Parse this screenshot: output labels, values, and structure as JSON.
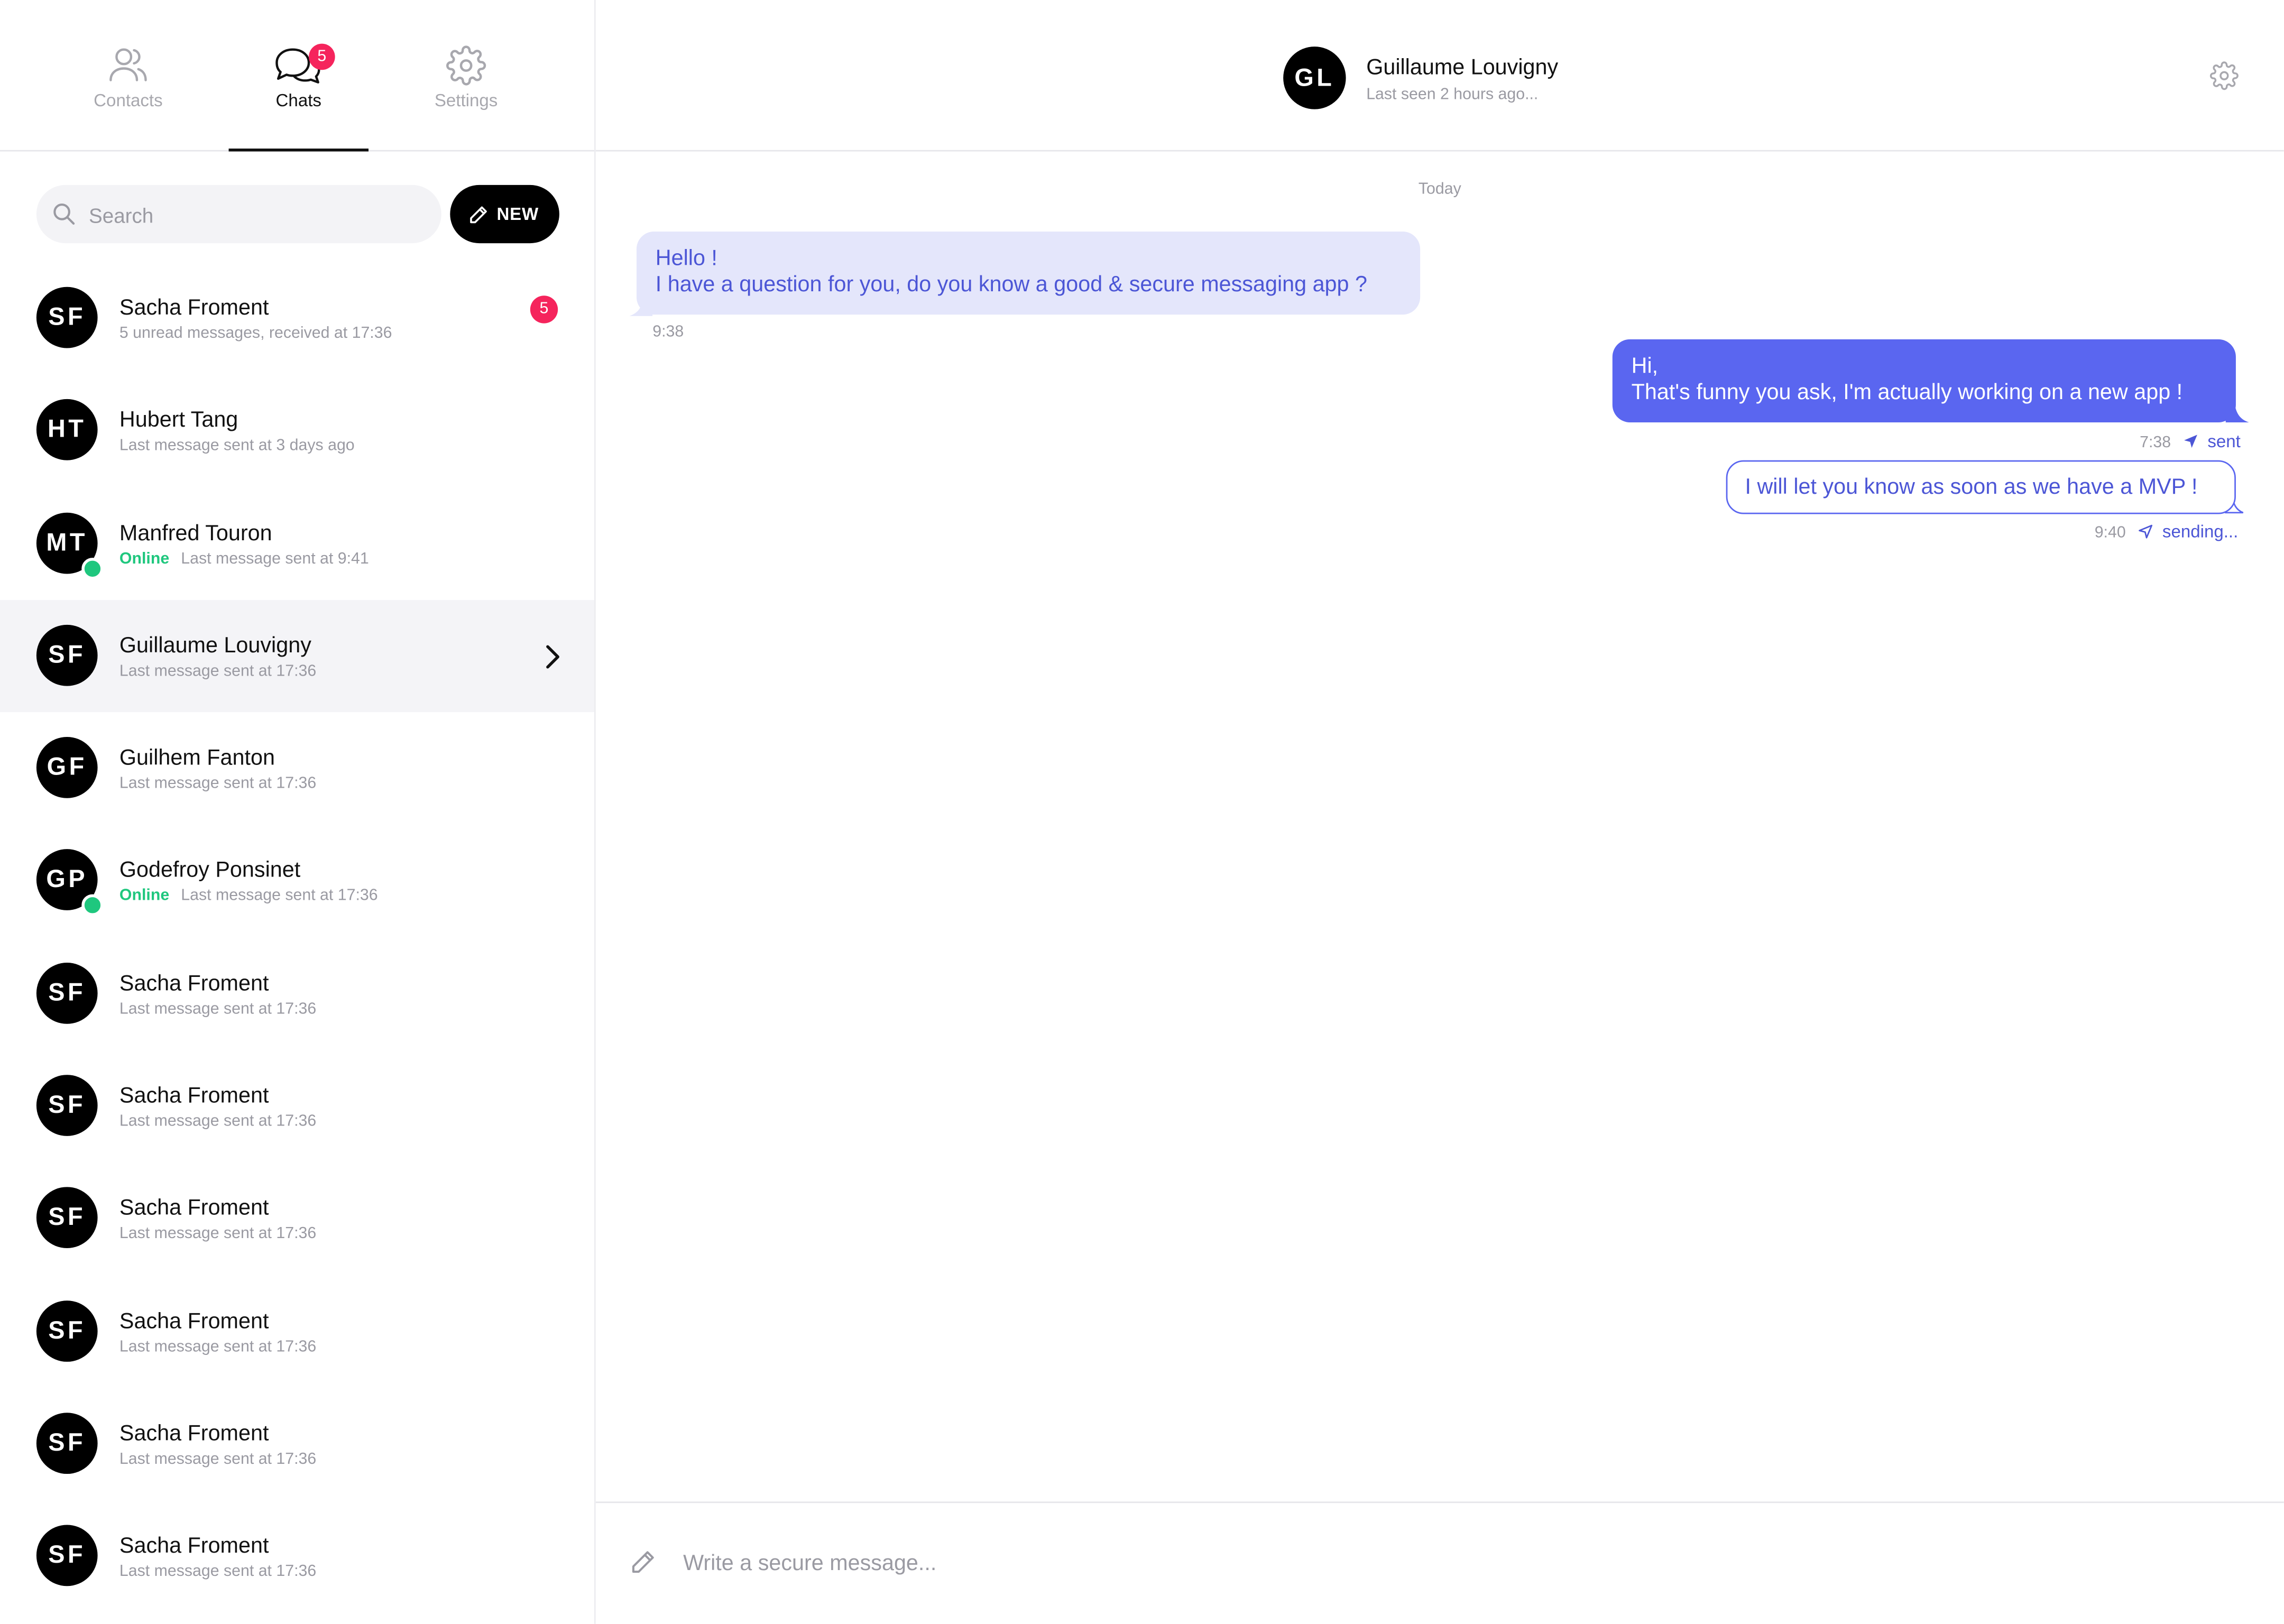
{
  "nav": {
    "tabs": [
      {
        "label": "Contacts",
        "icon": "users-icon"
      },
      {
        "label": "Chats",
        "icon": "chat-bubbles-icon",
        "badge": "5"
      },
      {
        "label": "Settings",
        "icon": "gear-icon"
      }
    ]
  },
  "search": {
    "placeholder": "Search",
    "value": ""
  },
  "new_button": {
    "label": "NEW"
  },
  "chats": [
    {
      "initials": "SF",
      "name": "Sacha Froment",
      "online": "",
      "sub": "5 unread messages, received at 17:36",
      "badge": "5"
    },
    {
      "initials": "HT",
      "name": "Hubert Tang",
      "online": "",
      "sub": "Last message sent at 3 days ago"
    },
    {
      "initials": "MT",
      "name": "Manfred Touron",
      "online": "Online",
      "sub": "Last message sent at 9:41"
    },
    {
      "initials": "SF",
      "name": "Guillaume Louvigny",
      "online": "",
      "sub": "Last message sent at 17:36"
    },
    {
      "initials": "GF",
      "name": "Guilhem Fanton",
      "online": "",
      "sub": "Last message sent at 17:36"
    },
    {
      "initials": "GP",
      "name": "Godefroy Ponsinet",
      "online": "Online",
      "sub": "Last message sent at 17:36"
    },
    {
      "initials": "SF",
      "name": "Sacha Froment",
      "online": "",
      "sub": "Last message sent at 17:36"
    },
    {
      "initials": "SF",
      "name": "Sacha Froment",
      "online": "",
      "sub": "Last message sent at 17:36"
    },
    {
      "initials": "SF",
      "name": "Sacha Froment",
      "online": "",
      "sub": "Last message sent at 17:36"
    },
    {
      "initials": "SF",
      "name": "Sacha Froment",
      "online": "",
      "sub": "Last message sent at 17:36"
    },
    {
      "initials": "SF",
      "name": "Sacha Froment",
      "online": "",
      "sub": "Last message sent at 17:36"
    },
    {
      "initials": "SF",
      "name": "Sacha Froment",
      "online": "",
      "sub": "Last message sent at 17:36"
    }
  ],
  "conversation": {
    "initials": "GL",
    "name": "Guillaume Louvigny",
    "status": "Last seen 2 hours ago...",
    "day_separator": "Today",
    "messages": [
      {
        "direction": "in",
        "line1": "Hello !",
        "line2": "I have a question for you, do you know a good & secure messaging app ?",
        "time": "9:38"
      },
      {
        "direction": "out",
        "line1": "Hi,",
        "line2": "That's funny you ask, I'm actually working on a new app !",
        "time": "7:38",
        "state": "sent"
      },
      {
        "direction": "out",
        "line1": "I will let you know as soon as we have a MVP !",
        "time": "9:40",
        "state": "sending..."
      }
    ]
  },
  "composer": {
    "placeholder": "Write a secure message...",
    "value": ""
  },
  "colors": {
    "accent": "#5a66f0",
    "accent_text": "#4c56d6",
    "incoming_bubble": "#e4e6fb",
    "badge": "#f5245c",
    "online": "#1fc77e",
    "selected_row": "#f4f4f7"
  }
}
